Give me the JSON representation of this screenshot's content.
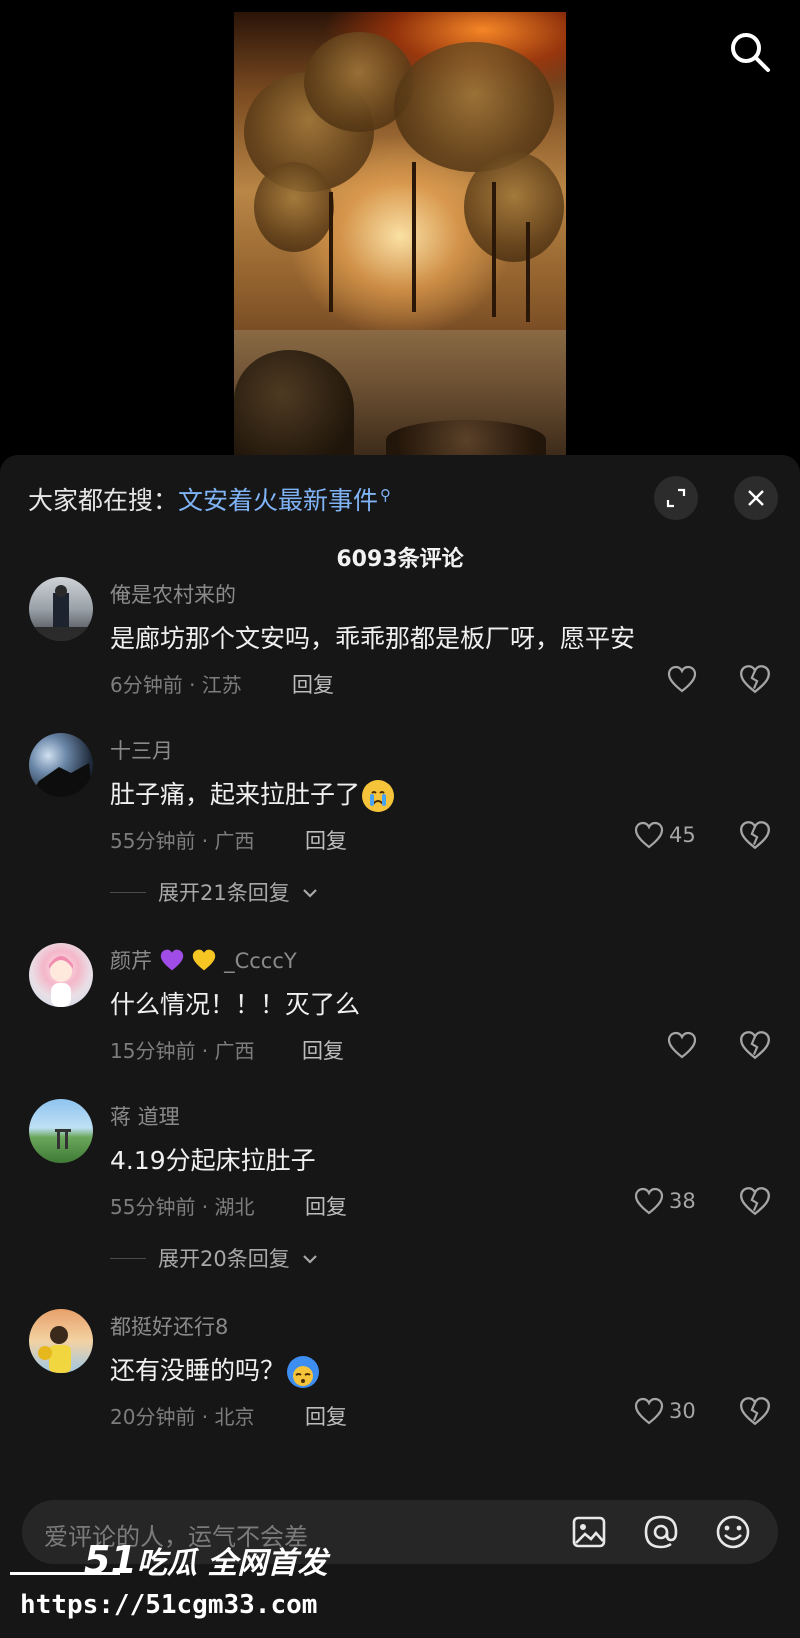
{
  "header": {
    "search_icon": "search-icon"
  },
  "sheet": {
    "search_prefix": "大家都在搜：",
    "search_link": "文安着火最新事件",
    "comment_count": "6093条评论",
    "icons": {
      "expand": "expand-icon",
      "close": "close-icon"
    }
  },
  "comments": [
    {
      "user": "俺是农村来的",
      "text": "是廊坊那个文安吗，乖乖那都是板厂呀，愿平安",
      "meta": "6分钟前 · 江苏",
      "reply": "回复",
      "likes": ""
    },
    {
      "user": "十三月",
      "text": "肚子痛，起来拉肚子了",
      "emoji": "crying-face-emoji",
      "meta": "55分钟前 · 广西",
      "reply": "回复",
      "likes": "45",
      "expand": "展开21条回复"
    },
    {
      "user": "颜芹",
      "user_suffix": "_CcccY",
      "user_emojis": [
        "purple-heart-emoji",
        "yellow-heart-emoji"
      ],
      "text": "什么情况！！！灭了么",
      "meta": "15分钟前 · 广西",
      "reply": "回复",
      "likes": ""
    },
    {
      "user": "蒋 道理",
      "text": "4.19分起床拉肚子",
      "meta": "55分钟前 · 湖北",
      "reply": "回复",
      "likes": "38",
      "expand": "展开20条回复"
    },
    {
      "user": "都挺好还行8",
      "text": "还有没睡的吗？",
      "emoji": "sleepy-face-emoji",
      "meta": "20分钟前 · 北京",
      "reply": "回复",
      "likes": "30"
    }
  ],
  "input": {
    "placeholder": "爱评论的人，运气不会差",
    "icons": [
      "image-icon",
      "at-icon",
      "emoji-icon"
    ]
  },
  "watermark": {
    "logo_num": "51",
    "logo_text": "吃瓜 全网首发",
    "url": "https://51cgm33.com"
  }
}
